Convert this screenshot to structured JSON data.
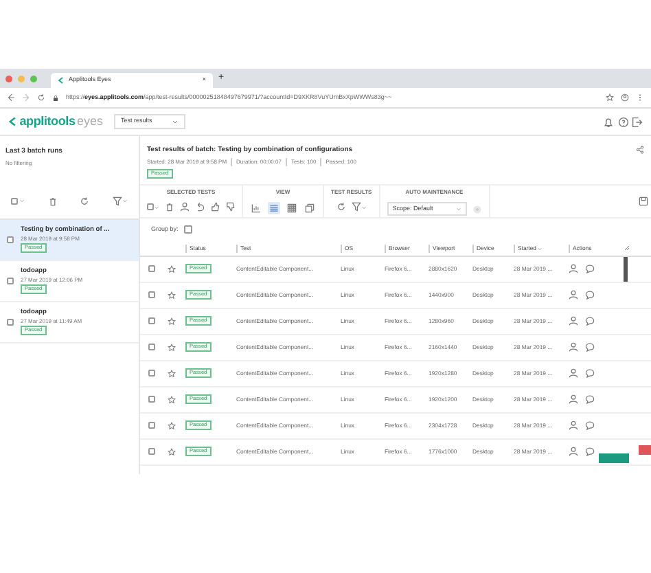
{
  "browser": {
    "tab_title": "Applitools Eyes",
    "tab_close": "×",
    "new_tab": "+",
    "url_prefix": "https://",
    "url_host": "eyes.applitools.com",
    "url_path": "/app/test-results/00000251848497679971/?accountId=D9XKR8VuYUmBxXpWWWs83g~~"
  },
  "app": {
    "logo_main": "applitools",
    "logo_sub": "eyes",
    "view_select": "Test results"
  },
  "sidebar": {
    "title": "Last 3 batch runs",
    "filter": "No filtering",
    "select_all_checked": false,
    "batches": [
      {
        "name": "Testing by combination of ...",
        "date": "28 Mar 2019 at 9:58 PM",
        "status": "Passed",
        "selected": true,
        "checked": false
      },
      {
        "name": "todoapp",
        "date": "27 Mar 2019 at 12:06 PM",
        "status": "Passed",
        "selected": false,
        "checked": false
      },
      {
        "name": "todoapp",
        "date": "27 Mar 2019 at 11:49 AM",
        "status": "Passed",
        "selected": false,
        "checked": false
      }
    ]
  },
  "batch": {
    "title": "Test results of batch: Testing by combination of configurations",
    "meta": [
      "Started: 28 Mar 2019 at 9:58 PM",
      "Duration: 00:00:07",
      "Tests: 100",
      "Passed: 100"
    ],
    "status": "Passed"
  },
  "toolbar": {
    "select_all_checked": false,
    "groups": [
      "SELECTED TESTS",
      "VIEW",
      "TEST RESULTS",
      "AUTO MAINTENANCE"
    ],
    "view_modes": [
      {
        "kind": "chart",
        "selected": false
      },
      {
        "kind": "list",
        "selected": true
      },
      {
        "kind": "grid",
        "selected": false
      },
      {
        "kind": "pages",
        "selected": false
      }
    ],
    "scope": "Scope: Default"
  },
  "group_by": "Group by:",
  "table": {
    "columns": [
      "Status",
      "Test",
      "OS",
      "Browser",
      "Viewport",
      "Device",
      "Started",
      "Actions"
    ],
    "rows": [
      {
        "checked": false,
        "status": "Passed",
        "test": "ContentEditable Component...",
        "os": "Linux",
        "browser": "Firefox 6...",
        "viewport": "2880x1620",
        "device": "Desktop",
        "started": "28 Mar 2019 ..."
      },
      {
        "checked": false,
        "status": "Passed",
        "test": "ContentEditable Component...",
        "os": "Linux",
        "browser": "Firefox 6...",
        "viewport": "1440x900",
        "device": "Desktop",
        "started": "28 Mar 2019 ..."
      },
      {
        "checked": false,
        "status": "Passed",
        "test": "ContentEditable Component...",
        "os": "Linux",
        "browser": "Firefox 6...",
        "viewport": "1280x960",
        "device": "Desktop",
        "started": "28 Mar 2019 ..."
      },
      {
        "checked": false,
        "status": "Passed",
        "test": "ContentEditable Component...",
        "os": "Linux",
        "browser": "Firefox 6...",
        "viewport": "2160x1440",
        "device": "Desktop",
        "started": "28 Mar 2019 ..."
      },
      {
        "checked": false,
        "status": "Passed",
        "test": "ContentEditable Component...",
        "os": "Linux",
        "browser": "Firefox 6...",
        "viewport": "1920x1280",
        "device": "Desktop",
        "started": "28 Mar 2019 ..."
      },
      {
        "checked": false,
        "status": "Passed",
        "test": "ContentEditable Component...",
        "os": "Linux",
        "browser": "Firefox 6...",
        "viewport": "1920x1200",
        "device": "Desktop",
        "started": "28 Mar 2019 ..."
      },
      {
        "checked": false,
        "status": "Passed",
        "test": "ContentEditable Component...",
        "os": "Linux",
        "browser": "Firefox 6...",
        "viewport": "2304x1728",
        "device": "Desktop",
        "started": "28 Mar 2019 ..."
      },
      {
        "checked": false,
        "status": "Passed",
        "test": "ContentEditable Component...",
        "os": "Linux",
        "browser": "Firefox 6...",
        "viewport": "1776x1000",
        "device": "Desktop",
        "started": "28 Mar 2019 ..."
      }
    ]
  }
}
